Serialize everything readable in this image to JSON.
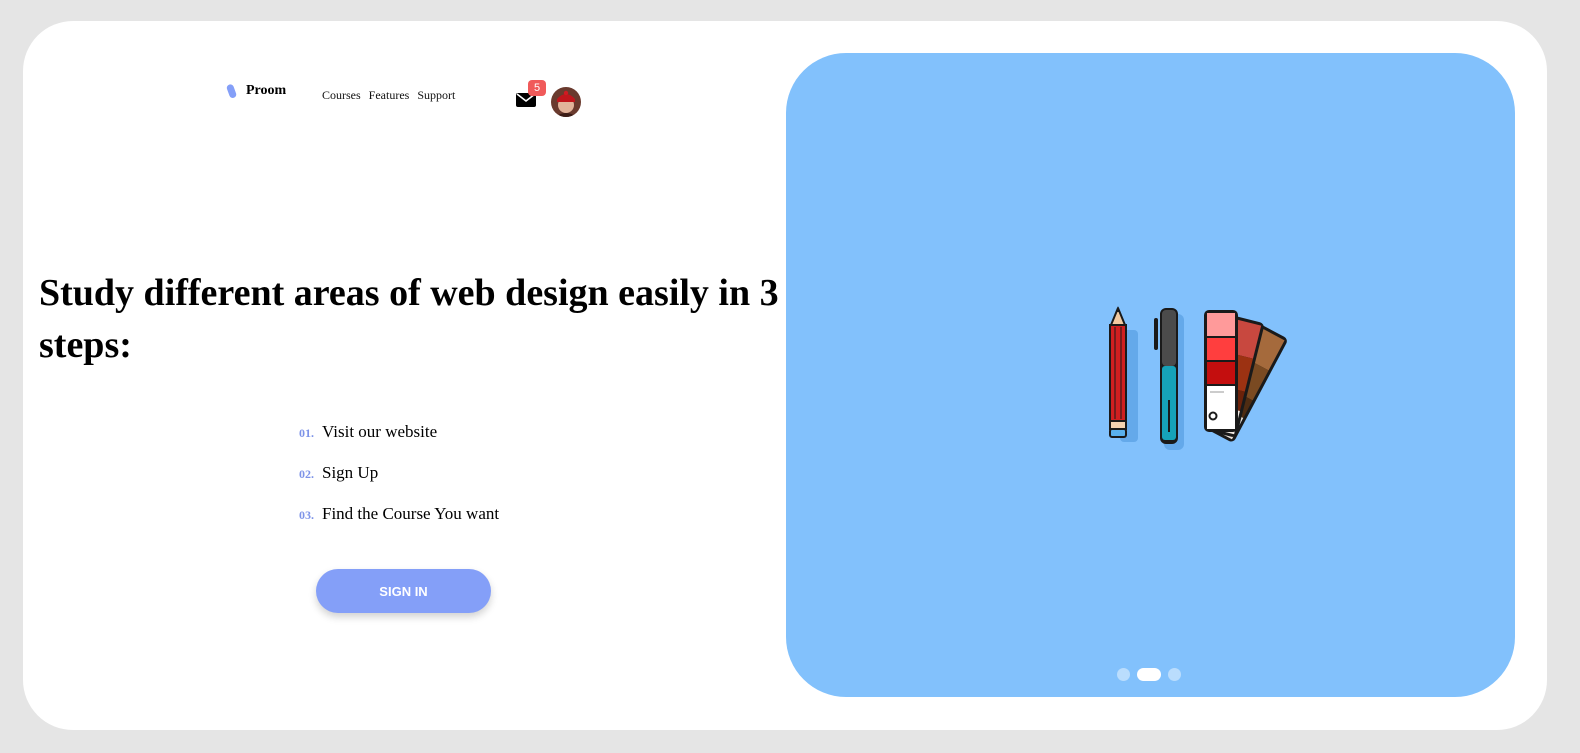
{
  "brand": {
    "name": "Proom",
    "color": "#849ff8"
  },
  "nav": {
    "items": [
      "Courses",
      "Features",
      "Support"
    ]
  },
  "header": {
    "mail_icon": "envelope-icon",
    "notification_count": "5",
    "badge_color": "#f05a5a"
  },
  "hero": {
    "headline": "Study different areas of web design easily in 3 steps:",
    "steps": [
      {
        "num": "01.",
        "text": "Visit our website"
      },
      {
        "num": "02.",
        "text": "Sign Up"
      },
      {
        "num": "03.",
        "text": "Find the Course You want"
      }
    ],
    "cta_label": "SIGN IN",
    "cta_color": "#849ff8"
  },
  "panel": {
    "background": "#82c1fc",
    "illustration_icons": [
      "pencil-icon",
      "marker-pen-icon",
      "color-swatch-fan-icon"
    ],
    "carousel": {
      "slides": 3,
      "active_index": 1
    }
  }
}
